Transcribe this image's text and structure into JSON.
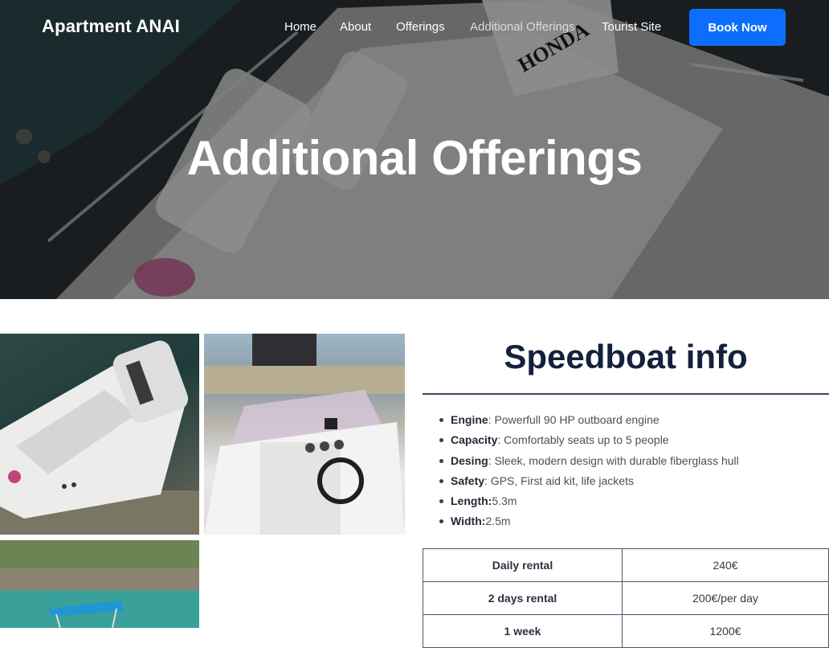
{
  "nav": {
    "brand": "Apartment ANAI",
    "links": [
      {
        "label": "Home",
        "active": false
      },
      {
        "label": "About",
        "active": false
      },
      {
        "label": "Offerings",
        "active": false
      },
      {
        "label": "Additional Offerings",
        "active": true
      },
      {
        "label": "Tourist Site",
        "active": false
      }
    ],
    "cta": "Book Now"
  },
  "hero": {
    "title": "Additional Offerings",
    "motor_text": "HONDA"
  },
  "gallery": [
    {
      "subject": "speedboat-stern-with-honda-outboard"
    },
    {
      "subject": "speedboat-cockpit-steering-console"
    },
    {
      "subject": "speedboat-with-blue-bimini-top-at-coast"
    }
  ],
  "info": {
    "title": "Speedboat info",
    "specs": [
      {
        "label": "Engine",
        "sep": ": ",
        "value": "Powerfull 90 HP outboard engine"
      },
      {
        "label": "Capacity",
        "sep": ": ",
        "value": "Comfortably seats up to 5 people"
      },
      {
        "label": "Desing",
        "sep": ": ",
        "value": "Sleek, modern design with durable fiberglass hull"
      },
      {
        "label": "Safety",
        "sep": ": ",
        "value": "GPS, First aid kit, life jackets"
      },
      {
        "label": "Length:",
        "sep": "",
        "value": "5.3m"
      },
      {
        "label": "Width:",
        "sep": "",
        "value": "2.5m"
      }
    ],
    "rates": [
      {
        "period": "Daily rental",
        "price": "240€"
      },
      {
        "period": "2 days rental",
        "price": "200€/per day"
      },
      {
        "period": "1 week",
        "price": "1200€"
      }
    ]
  },
  "colors": {
    "accent": "#0d6efd",
    "heading": "#13213c",
    "rule": "#384a63"
  }
}
